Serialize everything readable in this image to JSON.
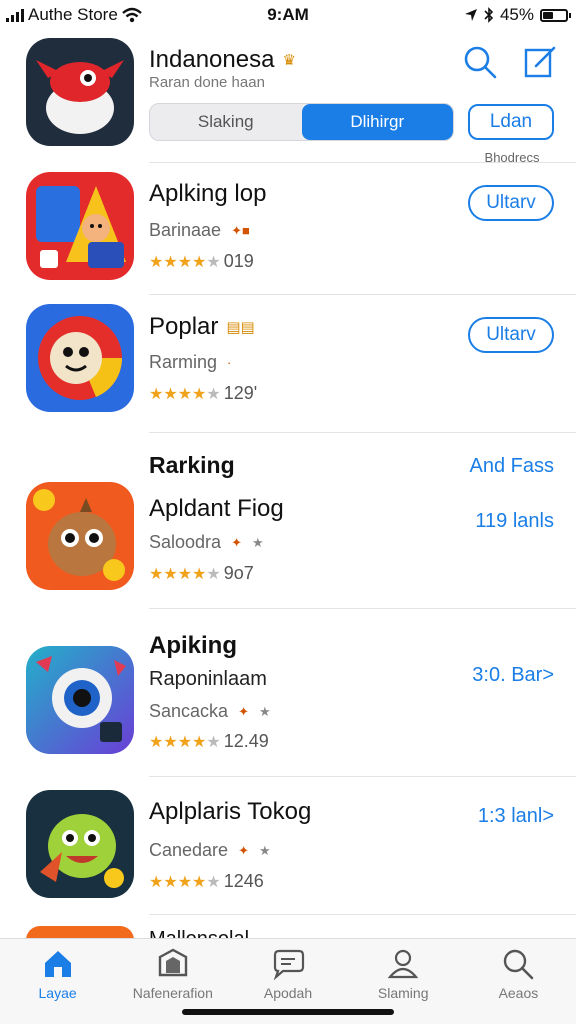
{
  "status_bar": {
    "carrier": "Authe Store",
    "time": "9:AM",
    "battery": "45%",
    "battery_level": 0.45
  },
  "header": {
    "title": "Indanonesa",
    "subtitle": "Raran done haan",
    "segments": [
      "Slaking",
      "Dlihirgr"
    ],
    "active_segment": 1,
    "button_label": "Ldan",
    "caption": "Bhodrecs"
  },
  "apps": [
    {
      "title": "Aplking lop",
      "subtitle": "Barinaae",
      "rating": 4,
      "count": "019",
      "button": "Ultarv"
    },
    {
      "title": "Poplar",
      "subtitle": "Rarming",
      "rating": 4,
      "count": "129'",
      "button": "Ultarv"
    }
  ],
  "ranking": {
    "header": "Rarking",
    "header_link": "And Fass",
    "items": [
      {
        "title": "Apldant Fiog",
        "subtitle": "Saloodra",
        "rating": 3.5,
        "count": "9o7",
        "link": "119 lanls"
      },
      {
        "title": "Apiking",
        "subtitle2": "Raponinlaam",
        "subtitle": "Sancacka",
        "rating": 3.5,
        "count": "12.49",
        "link": "3:0. Bar>"
      },
      {
        "title": "Aplplaris Tokog",
        "subtitle": "Canedare",
        "rating": 4,
        "count": "1246",
        "link": "1:3 lanl>"
      }
    ],
    "peek_title": "Mallonsolal"
  },
  "tabs": [
    {
      "label": "Layae",
      "icon": "home-icon"
    },
    {
      "label": "Nafenerafion",
      "icon": "box-icon"
    },
    {
      "label": "Apodah",
      "icon": "chat-icon"
    },
    {
      "label": "Slaming",
      "icon": "person-icon"
    },
    {
      "label": "Aeaos",
      "icon": "search-icon"
    }
  ],
  "colors": {
    "accent": "#1a7ee6",
    "star": "#f0a21a"
  }
}
